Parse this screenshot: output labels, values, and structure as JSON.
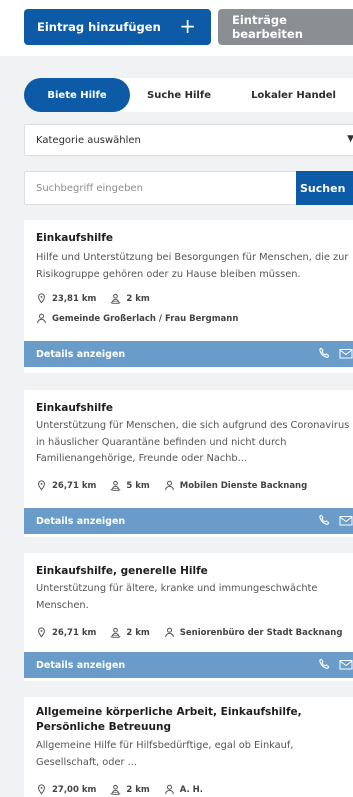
{
  "toolbar": {
    "add_label": "Eintrag hinzufügen",
    "add_icon": "plus-icon",
    "edit_label": "Einträge bearbeiten"
  },
  "tabs": [
    {
      "label": "Biete Hilfe",
      "active": true
    },
    {
      "label": "Suche Hilfe",
      "active": false
    },
    {
      "label": "Lokaler Handel",
      "active": false
    }
  ],
  "category": {
    "selected": "Kategorie auswählen"
  },
  "search": {
    "placeholder": "Suchbegriff eingeben",
    "button_label": "Suchen"
  },
  "listings": [
    {
      "title": "Einkaufshilfe",
      "description": "Hilfe und Unterstützung bei Besorgungen für Menschen, die zur Risikogruppe gehören oder zu Hause bleiben müssen.",
      "distance": "23,81 km",
      "radius": "2 km",
      "organization": "Gemeinde Großerlach / Frau Bergmann",
      "details_label": "Details anzeigen"
    },
    {
      "title": "Einkaufshilfe",
      "description": "Unterstützung für Menschen, die sich aufgrund des Coronavirus in häuslicher Quarantäne befinden und nicht durch Familienangehörige, Freunde oder Nachb...",
      "distance": "26,71 km",
      "radius": "5 km",
      "organization": "Mobilen Dienste Backnang",
      "details_label": "Details anzeigen"
    },
    {
      "title": "Einkaufshilfe, generelle Hilfe",
      "description": "Unterstützung für ältere, kranke und immungeschwächte Menschen.",
      "distance": "26,71 km",
      "radius": "2 km",
      "organization": "Seniorenbüro der Stadt Backnang",
      "details_label": "Details anzeigen"
    },
    {
      "title": "Allgemeine körperliche Arbeit, Einkaufshilfe, Persönliche Betreuung",
      "description": "Allgemeine Hilfe für Hilfsbedürftige, egal ob Einkauf, Gesellschaft, oder ...",
      "distance": "27,00 km",
      "radius": "2 km",
      "organization": "A. H."
    }
  ],
  "colors": {
    "primary": "#0d5aa6",
    "secondary_button": "#8b8f94",
    "card_footer": "#6a9cc9",
    "background": "#f1f2f4"
  }
}
